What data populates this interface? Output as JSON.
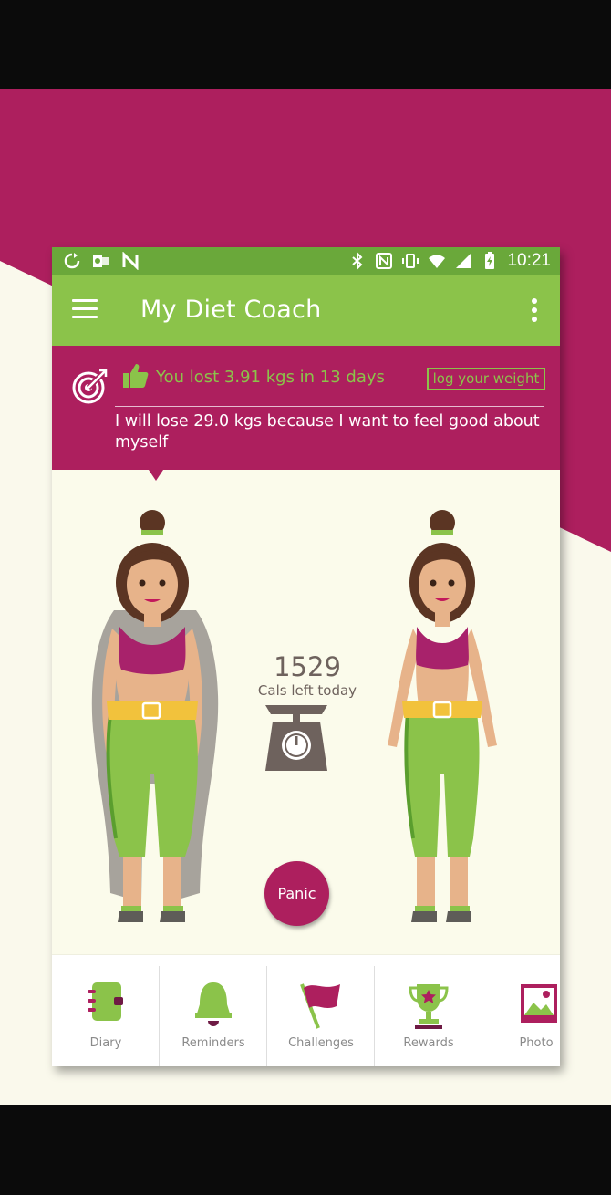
{
  "status_bar": {
    "time": "10:21"
  },
  "app_bar": {
    "title": "My Diet Coach"
  },
  "banner": {
    "progress_text": "You lost 3.91 kgs in 13 days",
    "log_button": "log your weight",
    "goal_text": "I will lose 29.0 kgs because I want to feel good about myself"
  },
  "main": {
    "calories_value": "1529",
    "calories_label": "Cals left today",
    "panic_button": "Panic"
  },
  "bottom_nav": {
    "items": [
      {
        "label": "Diary",
        "icon": "diary-icon"
      },
      {
        "label": "Reminders",
        "icon": "bell-icon"
      },
      {
        "label": "Challenges",
        "icon": "flag-icon"
      },
      {
        "label": "Rewards",
        "icon": "trophy-icon"
      },
      {
        "label": "Photo",
        "icon": "photo-icon"
      }
    ]
  },
  "colors": {
    "brand_magenta": "#ad1f5e",
    "brand_green": "#8bc34a",
    "status_green": "#6aa83a",
    "background_cream": "#fbfbeb"
  }
}
